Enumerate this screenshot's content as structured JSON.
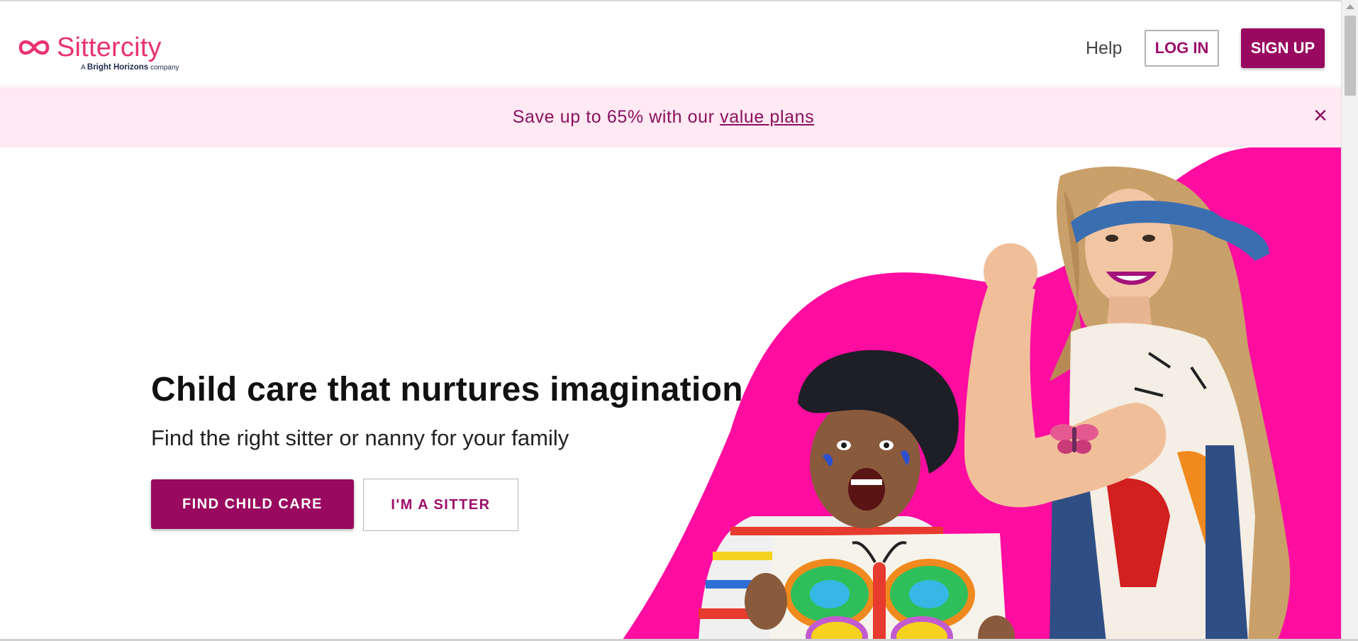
{
  "header": {
    "logo_text": "Sittercity",
    "logo_tagline_prefix": "A",
    "logo_tagline_brand": "Bright Horizons",
    "logo_tagline_suffix": "company",
    "help_label": "Help",
    "login_label": "LOG IN",
    "signup_label": "SIGN UP"
  },
  "banner": {
    "text": "Save up to 65% with our ",
    "link_text": "value plans",
    "close_icon": "close-icon"
  },
  "hero": {
    "title": "Child care that nurtures imagination",
    "subtitle": "Find the right sitter or nanny for your family",
    "primary_cta": "FIND CHILD CARE",
    "secondary_cta": "I'M A SITTER",
    "image_alt": "Smiling woman flexing arm next to excited child holding a butterfly drawing"
  },
  "colors": {
    "brand_pink": "#e8336e",
    "brand_plum": "#99095f",
    "banner_bg": "#ffe9f3",
    "hero_magenta": "#ff0ca0"
  }
}
